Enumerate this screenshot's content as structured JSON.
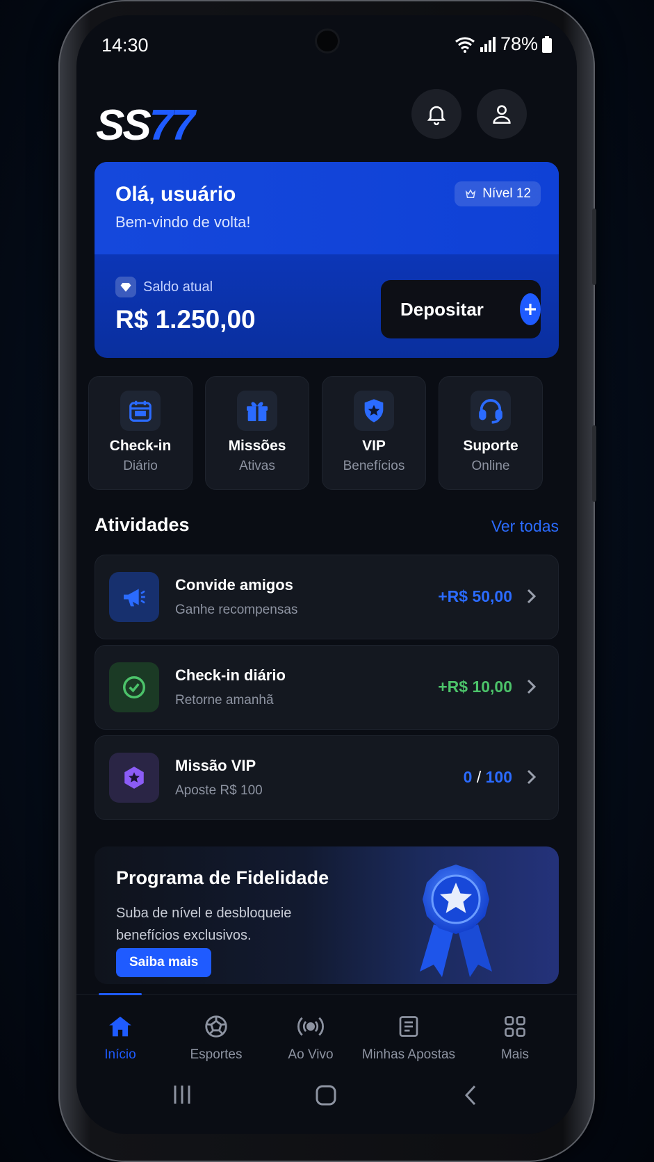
{
  "status": {
    "time": "14:30",
    "battery": "78%"
  },
  "header": {
    "logo_main": "SS",
    "logo_accent": "77"
  },
  "welcome": {
    "greeting": "Olá, usuário",
    "subtitle": "Bem-vindo de volta!",
    "level": "Nível 12",
    "balance_label": "Saldo atual",
    "balance_value": "R$ 1.250,00",
    "deposit_label": "Depositar"
  },
  "quick_actions": [
    {
      "title": "Check-in",
      "subtitle": "Diário",
      "icon": "calendar-icon"
    },
    {
      "title": "Missões",
      "subtitle": "Ativas",
      "icon": "gift-icon"
    },
    {
      "title": "VIP",
      "subtitle": "Benefícios",
      "icon": "shield-star-icon"
    },
    {
      "title": "Suporte",
      "subtitle": "Online",
      "icon": "headset-icon"
    }
  ],
  "activities": {
    "title": "Atividades",
    "see_all": "Ver todas",
    "items": [
      {
        "title": "Convide amigos",
        "subtitle": "Ganhe recompensas",
        "value": "+R$ 50,00",
        "color": "#2b6bff",
        "icon": "megaphone-icon"
      },
      {
        "title": "Check-in diário",
        "subtitle": "Retorne amanhã",
        "value": "+R$ 10,00",
        "color": "#4cc36a",
        "icon": "check-circle-icon"
      },
      {
        "title": "Missão VIP",
        "subtitle": "Aposte R$ 100",
        "value_current": "0",
        "value_sep": "/",
        "value_target": "100",
        "color": "#2b6bff",
        "icon": "hexagon-star-icon"
      }
    ]
  },
  "loyalty": {
    "title": "Programa de Fidelidade",
    "description": "Suba de nível e desbloqueie benefícios exclusivos.",
    "button": "Saiba mais"
  },
  "nav": [
    {
      "label": "Início",
      "icon": "home-icon",
      "active": true
    },
    {
      "label": "Esportes",
      "icon": "ball-icon"
    },
    {
      "label": "Ao Vivo",
      "icon": "live-icon"
    },
    {
      "label": "Minhas Apostas",
      "icon": "ticket-icon"
    },
    {
      "label": "Mais",
      "icon": "grid-icon"
    }
  ],
  "colors": {
    "accent": "#1f5bff",
    "success": "#4cc36a",
    "vip": "#8b5cf6"
  }
}
